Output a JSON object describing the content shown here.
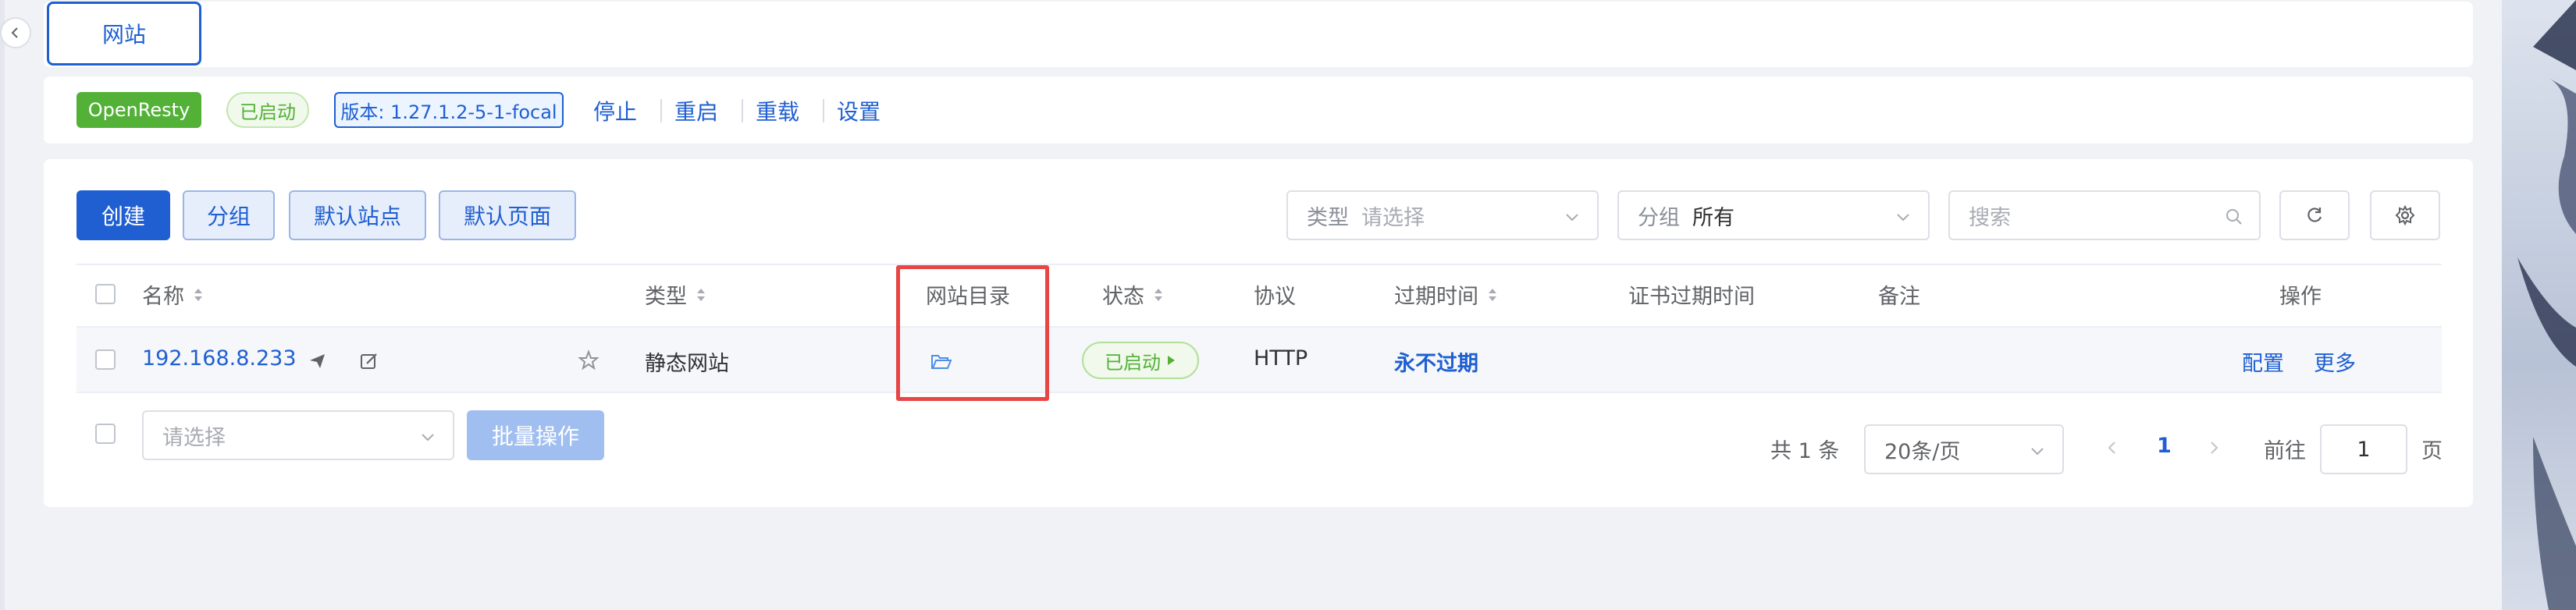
{
  "tabs": [
    {
      "label": "网站"
    }
  ],
  "status_bar": {
    "server_name": "OpenResty",
    "state": "已启动",
    "version": "版本: 1.27.1.2-5-1-focal",
    "actions": [
      "停止",
      "重启",
      "重载",
      "设置"
    ]
  },
  "toolbar": {
    "buttons": [
      "创建",
      "分组",
      "默认站点",
      "默认页面"
    ],
    "type_filter": {
      "label": "类型",
      "placeholder": "请选择"
    },
    "group_filter": {
      "label": "分组",
      "value": "所有"
    },
    "search": {
      "placeholder": "搜索"
    }
  },
  "table": {
    "columns": [
      "名称",
      "类型",
      "网站目录",
      "状态",
      "协议",
      "过期时间",
      "证书过期时间",
      "备注",
      "操作"
    ],
    "rows": [
      {
        "name": "192.168.8.233",
        "type": "静态网站",
        "status": "已启动",
        "protocol": "HTTP",
        "expire": "永不过期",
        "actions": [
          "配置",
          "更多"
        ]
      }
    ]
  },
  "batch": {
    "placeholder": "请选择",
    "button": "批量操作"
  },
  "pagination": {
    "total": "共 1 条",
    "page_size": "20条/页",
    "current": "1",
    "goto_label": "前往",
    "goto_value": "1",
    "page_suffix": "页"
  },
  "colors": {
    "primary": "#1f5fd1",
    "success": "#52b136",
    "highlight": "#e84545"
  }
}
